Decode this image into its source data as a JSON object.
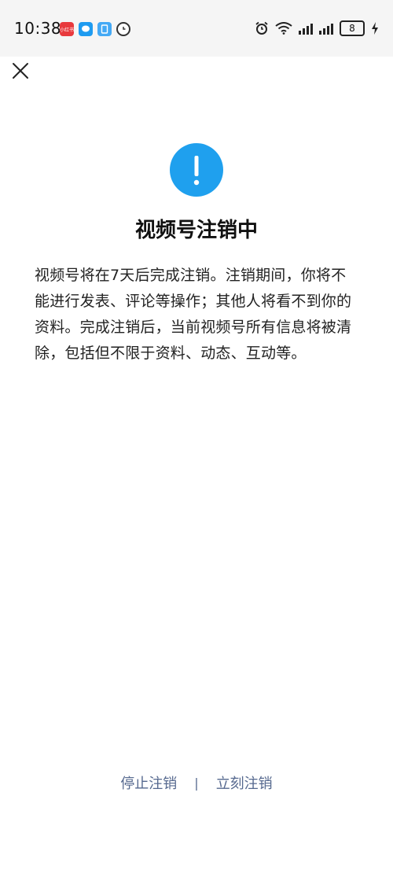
{
  "status_bar": {
    "time": "10:38",
    "app_icons": [
      "xiaohongshu-icon",
      "chat-icon",
      "note-icon",
      "clock-icon"
    ],
    "battery_level": "8",
    "indicators": [
      "alarm-icon",
      "wifi-icon",
      "signal-icon",
      "signal-icon",
      "charging-icon"
    ]
  },
  "header": {
    "close_icon": "close-icon"
  },
  "notice": {
    "icon": "alert-icon",
    "icon_color": "#1fa0ee",
    "title": "视频号注销中",
    "description": "视频号将在7天后完成注销。注销期间，你将不能进行发表、评论等操作；其他人将看不到你的资料。完成注销后，当前视频号所有信息将被清除，包括但不限于资料、动态、互动等。"
  },
  "actions": {
    "stop_label": "停止注销",
    "separator": "|",
    "immediate_label": "立刻注销",
    "color": "#56698f"
  }
}
